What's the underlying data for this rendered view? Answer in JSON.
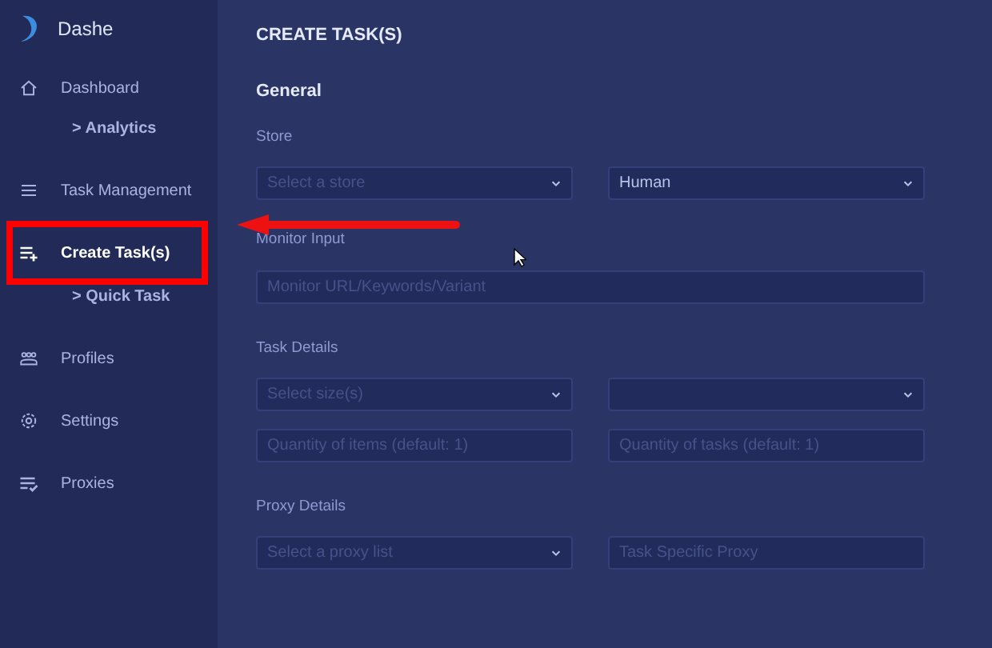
{
  "app": {
    "name": "Dashe"
  },
  "sidebar": {
    "items": [
      {
        "label": "Dashboard",
        "selected": false,
        "children": [
          {
            "label": "> Analytics"
          }
        ]
      },
      {
        "label": "Task Management",
        "selected": false
      },
      {
        "label": "Create Task(s)",
        "selected": true,
        "children": [
          {
            "label": "> Quick Task"
          }
        ]
      },
      {
        "label": "Profiles",
        "selected": false
      },
      {
        "label": "Settings",
        "selected": false
      },
      {
        "label": "Proxies",
        "selected": false
      }
    ]
  },
  "page": {
    "title": "CREATE TASK(S)",
    "heading": "General",
    "sections": [
      {
        "label": "Store",
        "rows": [
          [
            {
              "kind": "select",
              "placeholder": "Select a store"
            },
            {
              "kind": "select",
              "value": "Human"
            }
          ]
        ]
      },
      {
        "label": "Monitor Input",
        "rows": [
          [
            {
              "kind": "input",
              "placeholder": "Monitor URL/Keywords/Variant"
            }
          ]
        ]
      },
      {
        "label": "Task Details",
        "rows": [
          [
            {
              "kind": "select",
              "placeholder": "Select size(s)"
            },
            {
              "kind": "select"
            }
          ],
          [
            {
              "kind": "input",
              "placeholder": "Quantity of items (default: 1)"
            },
            {
              "kind": "input",
              "placeholder": "Quantity of tasks (default: 1)"
            }
          ]
        ]
      },
      {
        "label": "Proxy Details",
        "rows": [
          [
            {
              "kind": "select",
              "placeholder": "Select a proxy list"
            },
            {
              "kind": "input",
              "placeholder": "Task Specific Proxy"
            }
          ]
        ]
      }
    ]
  }
}
